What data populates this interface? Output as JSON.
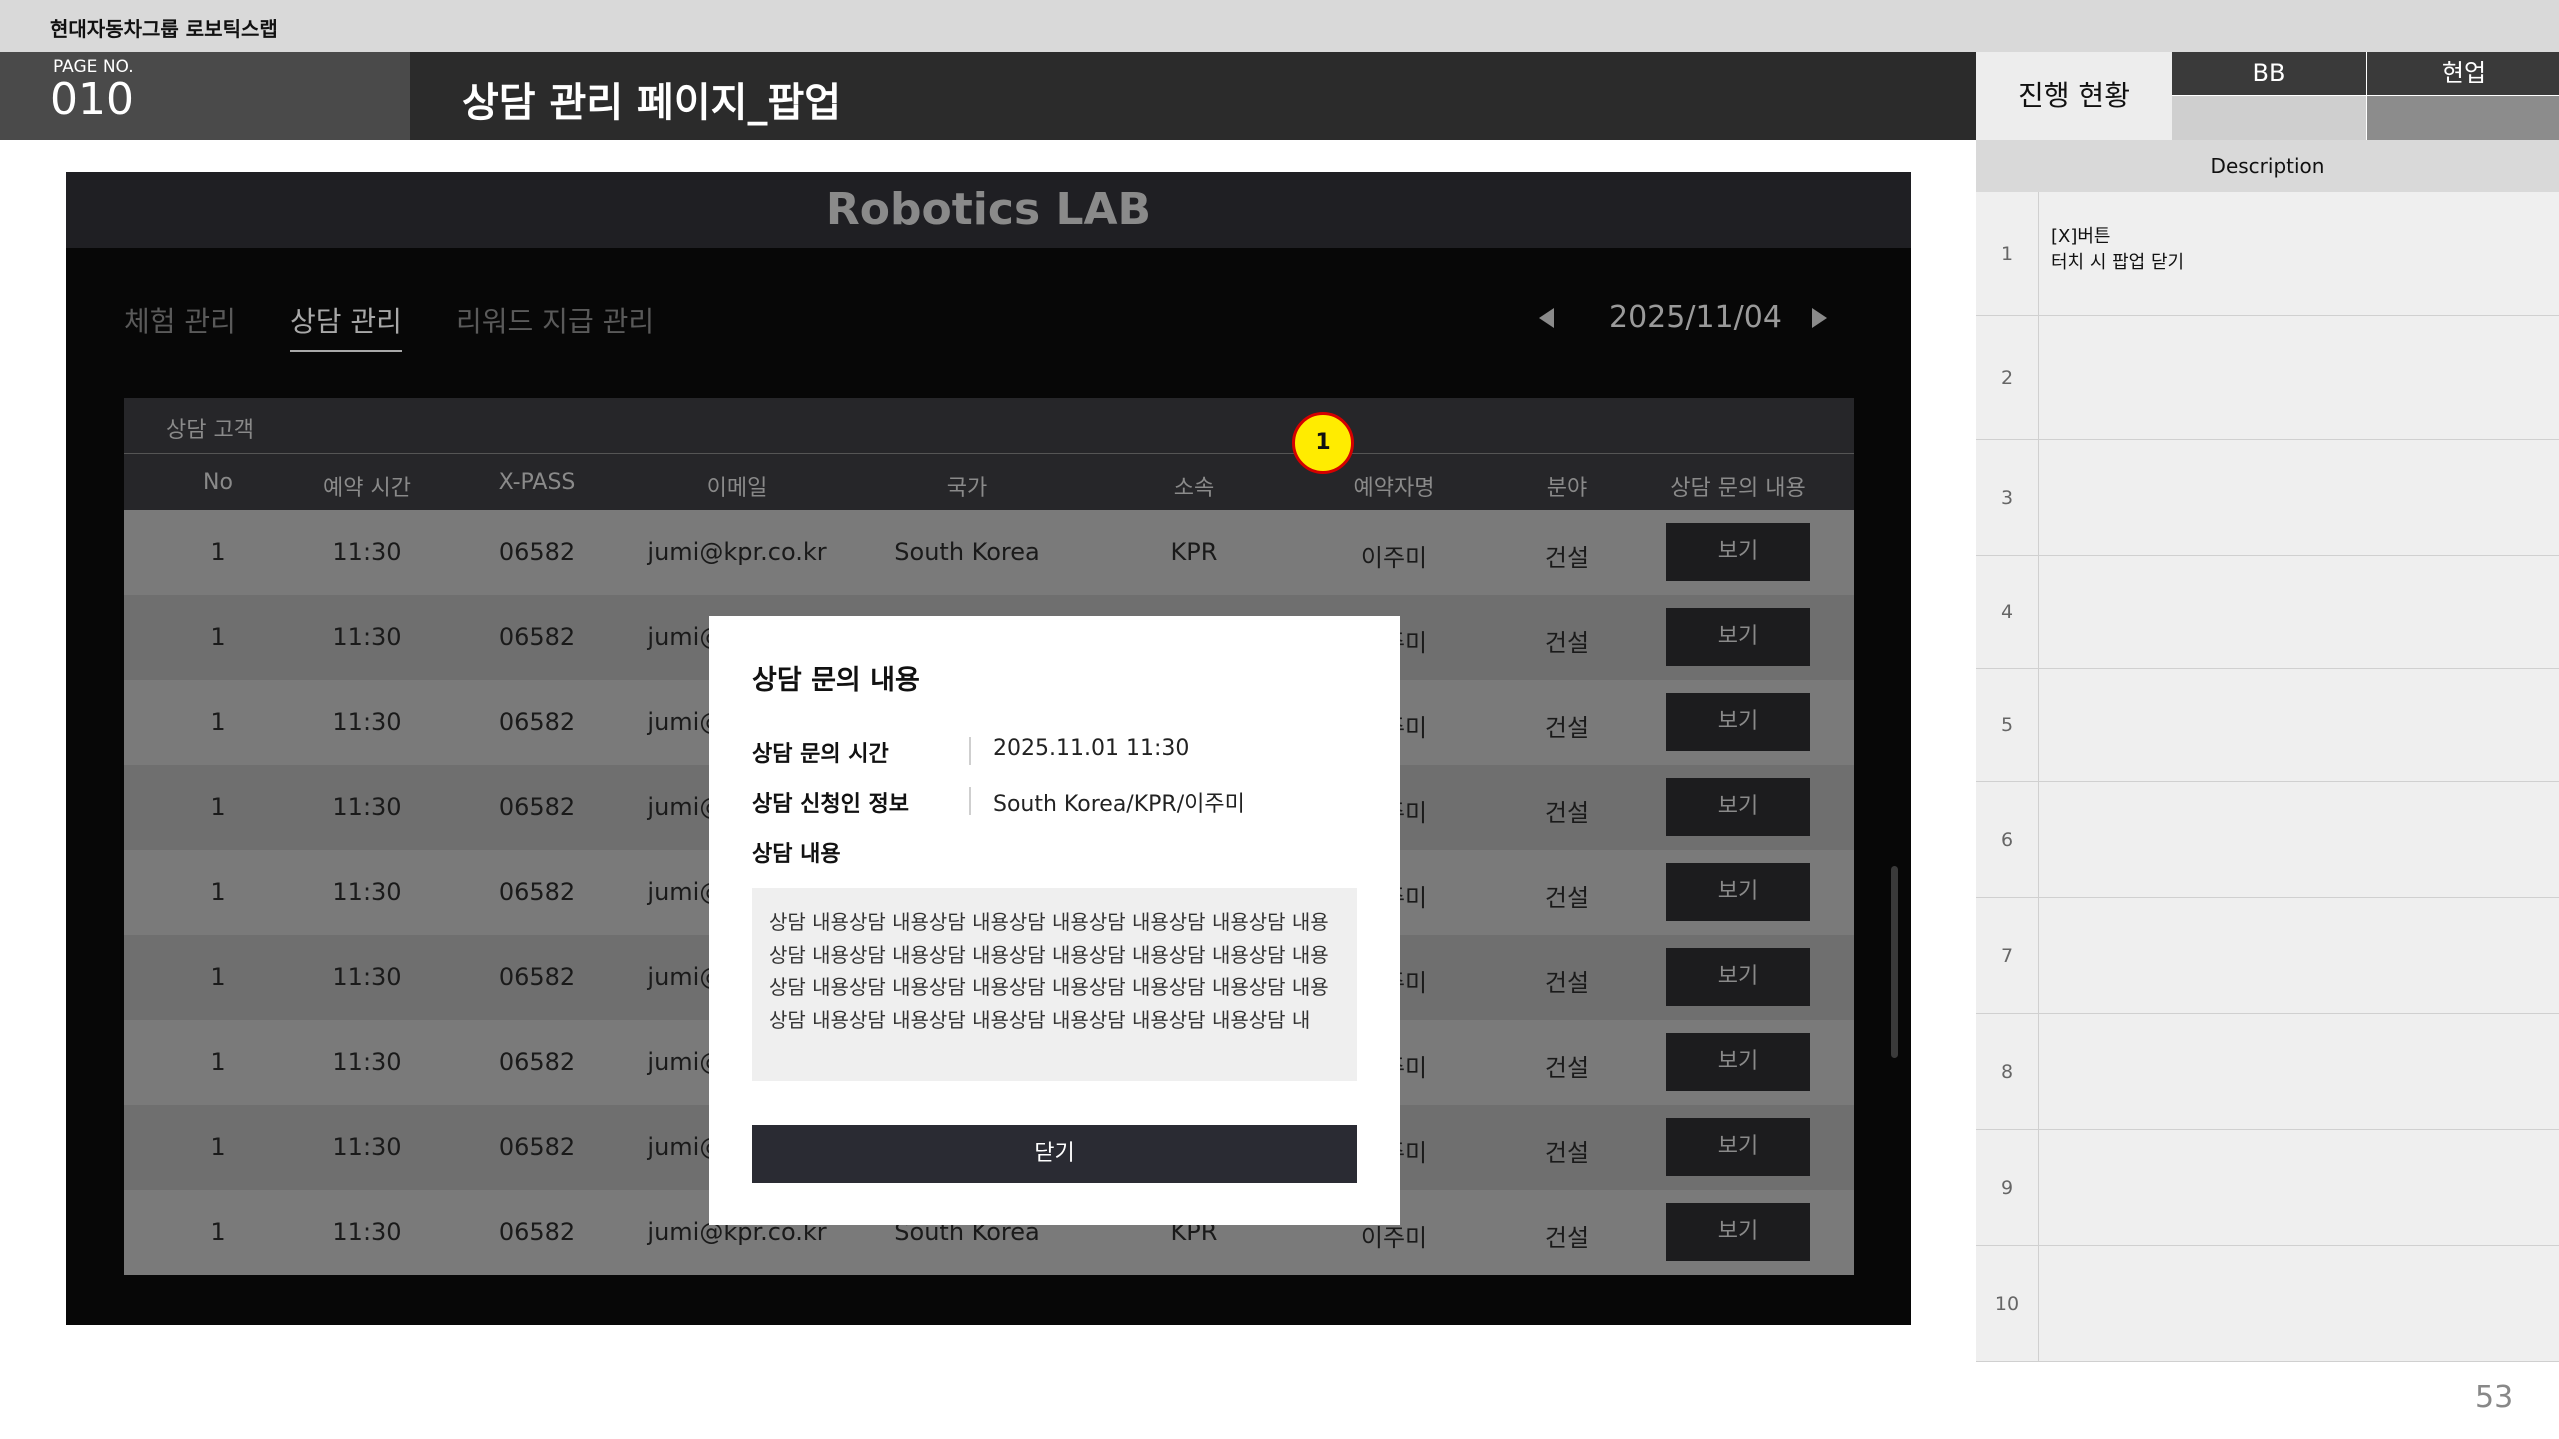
{
  "company": "현대자동차그룹 로보틱스랩",
  "page": {
    "no_label": "PAGE NO.",
    "no": "010",
    "title": "상담 관리 페이지_팝업",
    "page_number": "53"
  },
  "status": {
    "label": "진행 현황",
    "columns": [
      {
        "header": "BB",
        "value": ""
      },
      {
        "header": "현업",
        "value": ""
      }
    ]
  },
  "description": {
    "header": "Description",
    "rows": [
      {
        "num": "1",
        "text": "[X]버튼\n터치 시 팝업 닫기"
      },
      {
        "num": "2",
        "text": ""
      },
      {
        "num": "3",
        "text": ""
      },
      {
        "num": "4",
        "text": ""
      },
      {
        "num": "5",
        "text": ""
      },
      {
        "num": "6",
        "text": ""
      },
      {
        "num": "7",
        "text": ""
      },
      {
        "num": "8",
        "text": ""
      },
      {
        "num": "9",
        "text": ""
      },
      {
        "num": "10",
        "text": ""
      }
    ]
  },
  "app": {
    "title": "Robotics LAB",
    "tabs": [
      {
        "label": "체험 관리",
        "active": false
      },
      {
        "label": "상담 관리",
        "active": true
      },
      {
        "label": "리워드 지급 관리",
        "active": false
      }
    ],
    "date": "2025/11/04",
    "table": {
      "caption": "상담 고객",
      "headers": [
        "No",
        "예약 시간",
        "X-PASS",
        "이메일",
        "국가",
        "소속",
        "예약자명",
        "분야",
        "상담 문의 내용"
      ],
      "rows": [
        {
          "no": "1",
          "time": "11:30",
          "xpass": "06582",
          "email": "jumi@kpr.co.kr",
          "country": "South Korea",
          "org": "KPR",
          "name": "이주미",
          "field": "건설",
          "action": "보기"
        },
        {
          "no": "1",
          "time": "11:30",
          "xpass": "06582",
          "email": "jumi@kpr.co.kr",
          "country": "South Korea",
          "org": "KPR",
          "name": "이주미",
          "field": "건설",
          "action": "보기"
        },
        {
          "no": "1",
          "time": "11:30",
          "xpass": "06582",
          "email": "jumi@kpr.co.kr",
          "country": "South Korea",
          "org": "KPR",
          "name": "이주미",
          "field": "건설",
          "action": "보기"
        },
        {
          "no": "1",
          "time": "11:30",
          "xpass": "06582",
          "email": "jumi@kpr.co.kr",
          "country": "South Korea",
          "org": "KPR",
          "name": "이주미",
          "field": "건설",
          "action": "보기"
        },
        {
          "no": "1",
          "time": "11:30",
          "xpass": "06582",
          "email": "jumi@kpr.co.kr",
          "country": "South Korea",
          "org": "KPR",
          "name": "이주미",
          "field": "건설",
          "action": "보기"
        },
        {
          "no": "1",
          "time": "11:30",
          "xpass": "06582",
          "email": "jumi@kpr.co.kr",
          "country": "South Korea",
          "org": "KPR",
          "name": "이주미",
          "field": "건설",
          "action": "보기"
        },
        {
          "no": "1",
          "time": "11:30",
          "xpass": "06582",
          "email": "jumi@kpr.co.kr",
          "country": "South Korea",
          "org": "KPR",
          "name": "이주미",
          "field": "건설",
          "action": "보기"
        },
        {
          "no": "1",
          "time": "11:30",
          "xpass": "06582",
          "email": "jumi@kpr.co.kr",
          "country": "South Korea",
          "org": "KPR",
          "name": "이주미",
          "field": "건설",
          "action": "보기"
        },
        {
          "no": "1",
          "time": "11:30",
          "xpass": "06582",
          "email": "jumi@kpr.co.kr",
          "country": "South Korea",
          "org": "KPR",
          "name": "이주미",
          "field": "건설",
          "action": "보기"
        }
      ]
    }
  },
  "modal": {
    "title": "상담 문의 내용",
    "info": [
      {
        "label": "상담 문의 시간",
        "value": "2025.11.01 11:30"
      },
      {
        "label": "상담 신청인 정보",
        "value": "South Korea/KPR/이주미"
      }
    ],
    "content_label": "상담 내용",
    "content": "상담 내용상담 내용상담 내용상담 내용상담 내용상담 내용상담 내용상담 내용상담 내용상담 내용상담 내용상담 내용상담 내용상담 내용상담 내용상담 내용상담 내용상담 내용상담 내용상담 내용상담 내용상담 내용상담 내용상담 내용상담 내용상담 내용상담 내용상담 내",
    "close_label": "닫기"
  },
  "callout": "1"
}
